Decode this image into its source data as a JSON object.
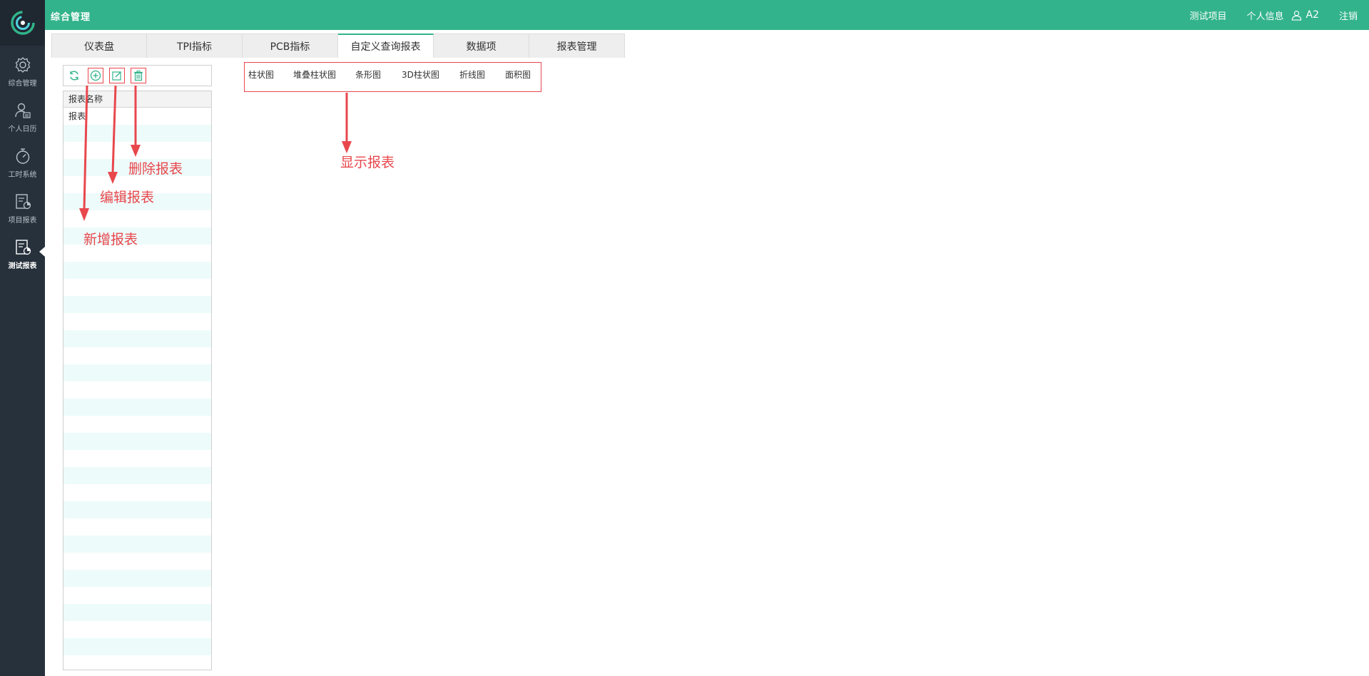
{
  "header": {
    "title": "综合管理",
    "project_link": "测试项目",
    "profile_link": "个人信息",
    "user_name": "A2",
    "logout_label": "注销",
    "accent_color": "#32b38b"
  },
  "sidebar": {
    "logo_icon": "spiral-logo-icon",
    "items": [
      {
        "label": "综合管理",
        "icon": "gear-icon"
      },
      {
        "label": "个人日历",
        "icon": "person-calendar-icon"
      },
      {
        "label": "工时系统",
        "icon": "stopwatch-icon"
      },
      {
        "label": "项目报表",
        "icon": "report-chart-icon"
      },
      {
        "label": "测试报表",
        "icon": "report-chart-icon",
        "active": true
      }
    ]
  },
  "tabs": [
    {
      "label": "仪表盘"
    },
    {
      "label": "TPI指标"
    },
    {
      "label": "PCB指标"
    },
    {
      "label": "自定义查询报表",
      "active": true
    },
    {
      "label": "数据项"
    },
    {
      "label": "报表管理"
    }
  ],
  "toolbar": {
    "buttons": [
      {
        "icon": "refresh-icon"
      },
      {
        "icon": "add-circle-icon"
      },
      {
        "icon": "edit-icon"
      },
      {
        "icon": "trash-icon"
      }
    ]
  },
  "report_table": {
    "header": "报表名称",
    "rows": [
      "报表"
    ]
  },
  "chart_types": [
    "柱状图",
    "堆叠柱状图",
    "条形图",
    "3D柱状图",
    "折线图",
    "面积图"
  ],
  "annotations": {
    "show_report": "显示报表",
    "delete_report": "删除报表",
    "edit_report": "编辑报表",
    "add_report": "新增报表",
    "color": "#e8474c"
  }
}
